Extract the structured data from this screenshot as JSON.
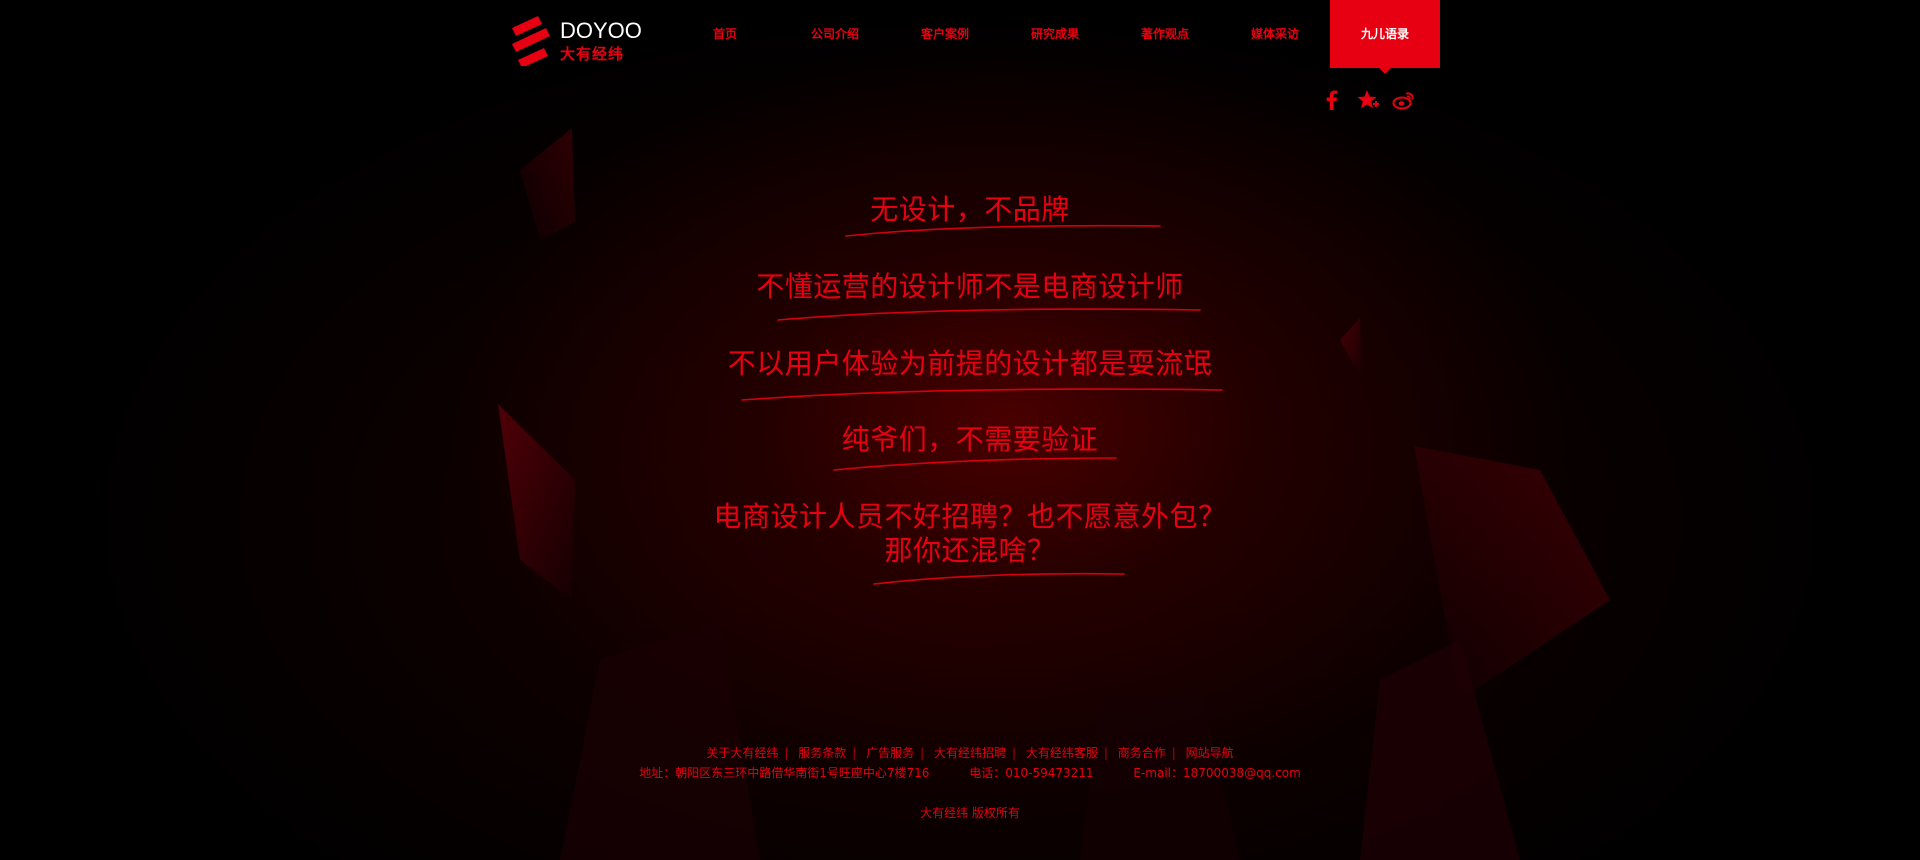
{
  "logo": {
    "en": "DOYOO",
    "cn": "大有经纬"
  },
  "nav": {
    "items": [
      {
        "label": "首页",
        "active": false
      },
      {
        "label": "公司介绍",
        "active": false
      },
      {
        "label": "客户案例",
        "active": false
      },
      {
        "label": "研究成果",
        "active": false
      },
      {
        "label": "著作观点",
        "active": false
      },
      {
        "label": "媒体采访",
        "active": false
      },
      {
        "label": "九儿语录",
        "active": true
      }
    ]
  },
  "social": {
    "icons": [
      "facebook-icon",
      "star-plus-icon",
      "weibo-icon"
    ]
  },
  "slogans": [
    {
      "text": "无设计，不品牌"
    },
    {
      "text": "不懂运营的设计师不是电商设计师"
    },
    {
      "text": "不以用户体验为前提的设计都是耍流氓"
    },
    {
      "text": "纯爷们，不需要验证"
    },
    {
      "line1": "电商设计人员不好招聘？也不愿意外包？",
      "line2": "那你还混啥？"
    }
  ],
  "footer": {
    "links": [
      "关于大有经纬",
      "服务条款",
      "广告服务",
      "大有经纬招聘",
      "大有经纬客服",
      "商务合作",
      "网站导航"
    ],
    "address": "地址：朝阳区东三环中路借华南街1号旺座中心7楼716",
    "phone": "电话：010-59473211",
    "email": "E-mail：18700038@qq.com",
    "copyright": "大有经纬 版权所有"
  },
  "colors": {
    "accent": "#e60012",
    "background": "#000000",
    "active_text": "#ffffff"
  }
}
